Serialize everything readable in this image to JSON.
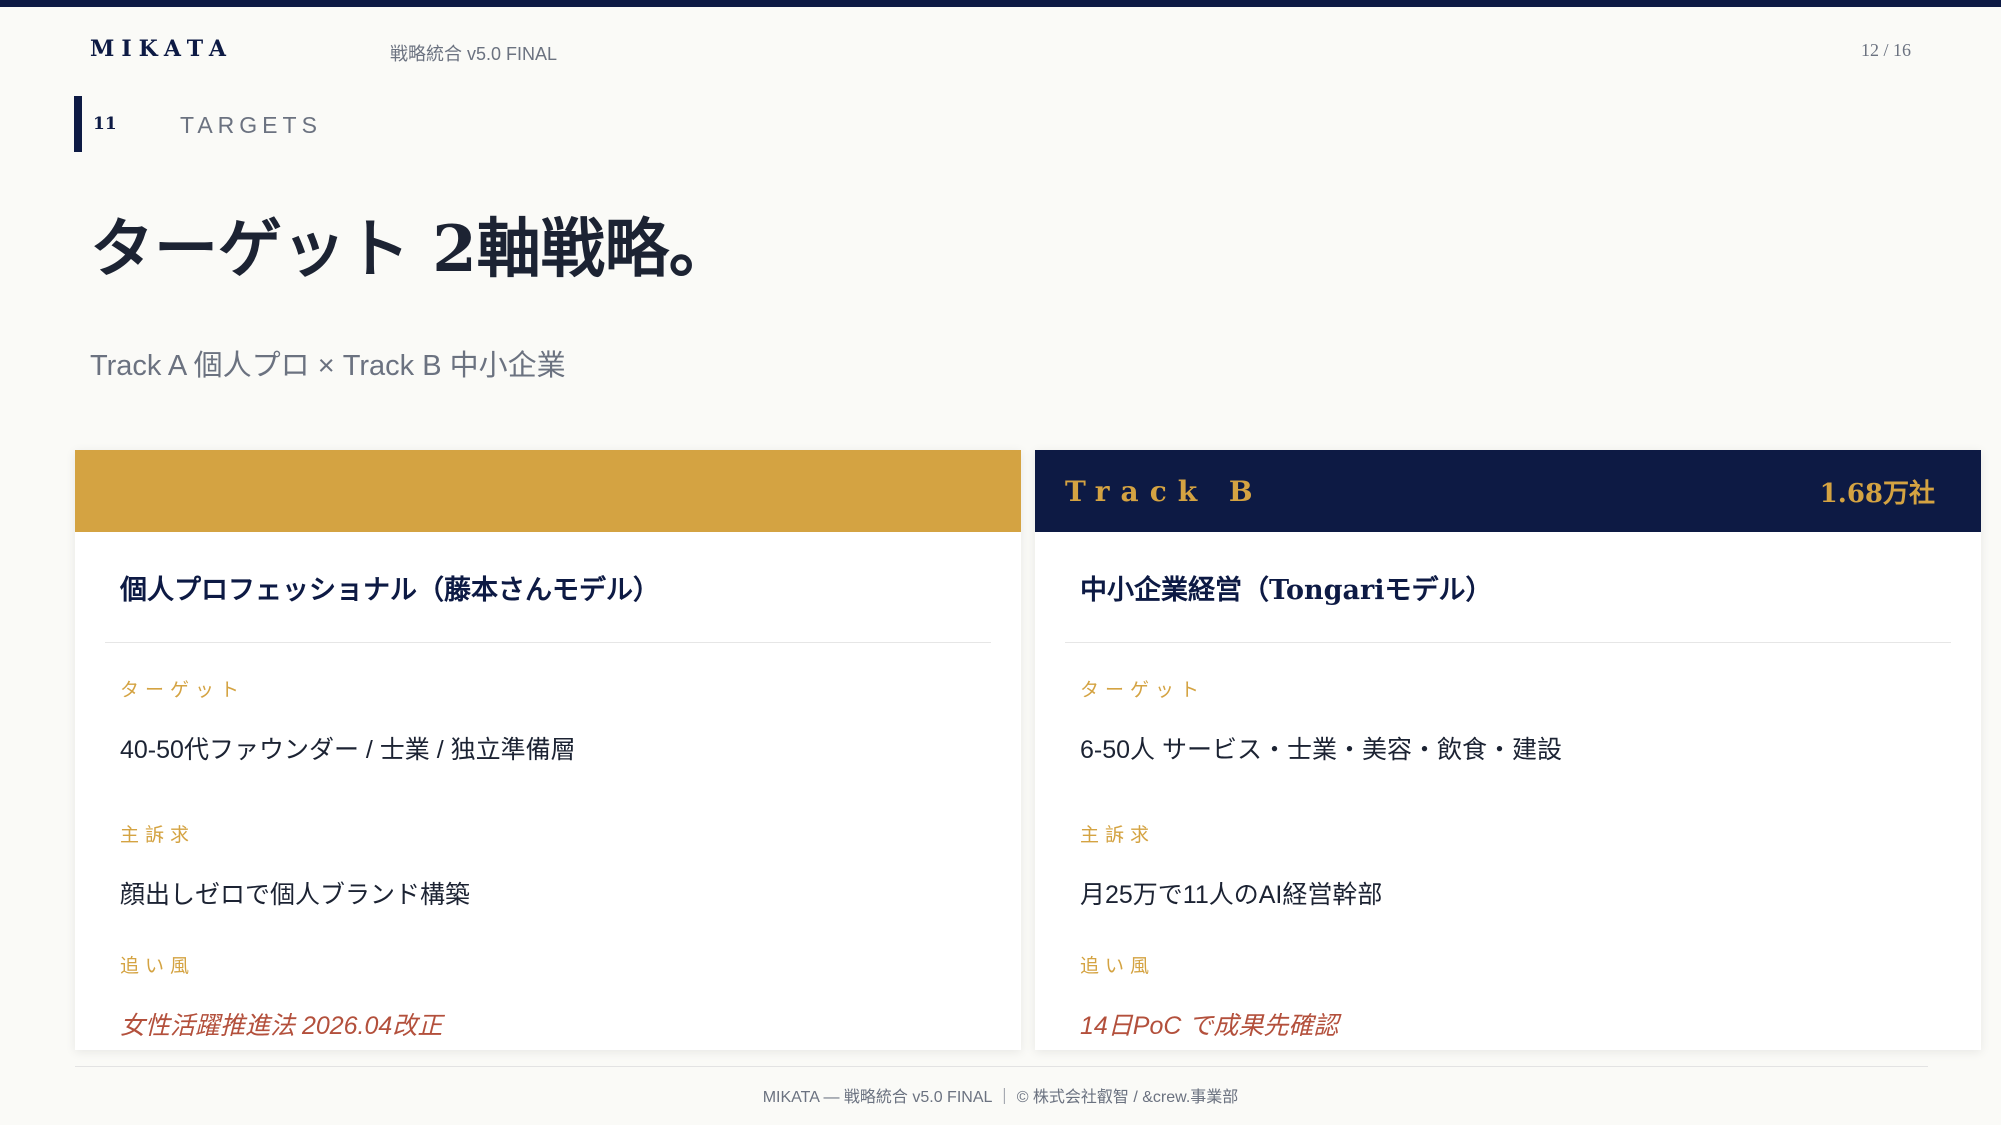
{
  "header": {
    "brand": "MIKATA",
    "doc_title": "戦略統合 v5.0 FINAL",
    "page_indicator": "12 / 16"
  },
  "section": {
    "number": "11",
    "label": "TARGETS"
  },
  "headline": "ターゲット 2軸戦略。",
  "subhead": "Track A 個人プロ × Track B 中小企業",
  "cards": [
    {
      "track_name": "",
      "track_count": "",
      "title": "個人プロフェッショナル（藤本さんモデル）",
      "target_label": "ターゲット",
      "target_value": "40-50代ファウンダー / 士業 / 独立準備層",
      "appeal_label": "主訴求",
      "appeal_value": "顔出しゼロで個人ブランド構築",
      "tailwind_label": "追い風",
      "tailwind_value": "女性活躍推進法 2026.04改正"
    },
    {
      "track_name": "Track B",
      "track_count": "1.68万社",
      "title": "中小企業経営（Tongariモデル）",
      "target_label": "ターゲット",
      "target_value": "6-50人 サービス・士業・美容・飲食・建設",
      "appeal_label": "主訴求",
      "appeal_value": "月25万で11人のAI経営幹部",
      "tailwind_label": "追い風",
      "tailwind_value": "14日PoC で成果先確認"
    }
  ],
  "footer": "MIKATA — 戦略統合 v5.0 FINAL ｜ © 株式会社叡智 / &crew.事業部",
  "colors": {
    "navy": "#0d1a44",
    "gold": "#d4a342",
    "accent_red": "#b3503c",
    "muted": "#6b7280",
    "background": "#fafaf7"
  }
}
